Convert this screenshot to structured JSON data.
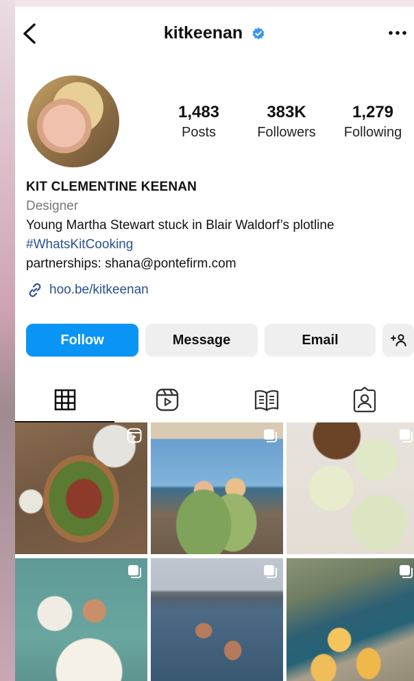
{
  "header": {
    "username": "kitkeenan",
    "verified": true
  },
  "stats": [
    {
      "value": "1,483",
      "label": "Posts"
    },
    {
      "value": "383K",
      "label": "Followers"
    },
    {
      "value": "1,279",
      "label": "Following"
    }
  ],
  "bio": {
    "name": "KIT CLEMENTINE KEENAN",
    "category": "Designer",
    "line1": "Young Martha Stewart stuck in Blair Waldorf’s plotline",
    "hashtag": "#WhatsKitCooking",
    "line3": "partnerships: shana@pontefirm.com",
    "link": "hoo.be/kitkeenan"
  },
  "buttons": {
    "follow": "Follow",
    "message": "Message",
    "email": "Email",
    "add_user": "+Ι"
  },
  "tabs": [
    "grid-icon",
    "reels-icon",
    "guides-icon",
    "tagged-icon"
  ],
  "colors": {
    "follow_blue": "#0a95f5",
    "verified_blue": "#3897f0",
    "link_blue": "#2b4f8e",
    "button_gray": "#efefef"
  }
}
